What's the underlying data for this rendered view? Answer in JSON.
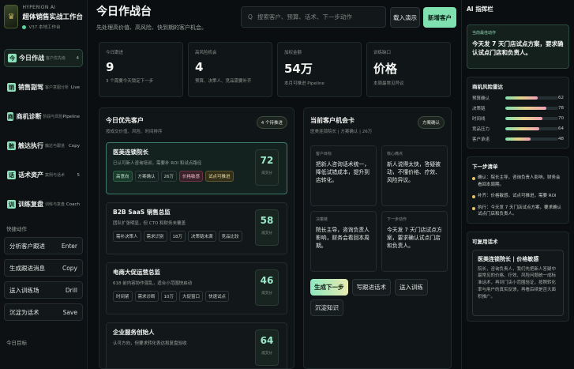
{
  "brand": {
    "tag": "HYPERION AI",
    "title": "超体销售实战工作台",
    "subtitle": "V37 本地工作台",
    "logo_glyph": "♛"
  },
  "nav": [
    {
      "icon": "今",
      "label": "今日作战",
      "sub": "客户优先级",
      "badge": "4",
      "active": true
    },
    {
      "icon": "销",
      "label": "销售副驾",
      "sub": "客户意图分析",
      "badge": "Live",
      "active": false
    },
    {
      "icon": "商",
      "label": "商机诊断",
      "sub": "阶段与风险",
      "badge": "Pipeline",
      "active": false
    },
    {
      "icon": "触",
      "label": "触达执行",
      "sub": "触达与跟进",
      "badge": "Copy",
      "active": false
    },
    {
      "icon": "话",
      "label": "话术资产",
      "sub": "案例与话术",
      "badge": "5",
      "active": false
    },
    {
      "icon": "训",
      "label": "训练复盘",
      "sub": "训练与复盘",
      "badge": "Coach",
      "active": false
    }
  ],
  "quick_actions": {
    "title": "快捷动作",
    "items": [
      {
        "label": "分析客户跟进",
        "key": "Enter"
      },
      {
        "label": "生成跟进消息",
        "key": "Copy"
      },
      {
        "label": "送入训练场",
        "key": "Drill"
      },
      {
        "label": "沉淀为话术",
        "key": "Save"
      }
    ]
  },
  "today_goal_label": "今日目标",
  "header": {
    "title": "今日作战台",
    "subtitle": "先处理高价值、高风险、快到期的客户机会。",
    "search_placeholder": "搜索客户、预算、话术、下一步动作",
    "demo_button": "载入演示",
    "new_button": "新增客户"
  },
  "stats": [
    {
      "label": "今日跟进",
      "value": "9",
      "desc": "3 个需要今天锁定下一步"
    },
    {
      "label": "高风险机会",
      "value": "4",
      "desc": "预算、决策人、竞品需要补齐"
    },
    {
      "label": "加权金额",
      "value": "54万",
      "desc": "本月可推进 Pipeline"
    },
    {
      "label": "训练缺口",
      "value": "价格",
      "desc": "本周最常见异议"
    }
  ],
  "priority": {
    "title": "今日优先客户",
    "subtitle": "按成交价值、风险、时间排序",
    "badge": "4 个待推进",
    "customers": [
      {
        "name": "医美连锁院长",
        "desc": "已认可新人咨询培训，需要补 ROI 和试点路径",
        "tags": [
          {
            "t": "高意向",
            "c": "g"
          },
          {
            "t": "方案确认",
            "c": ""
          },
          {
            "t": "26万",
            "c": ""
          },
          {
            "t": "价格敏感",
            "c": "r"
          },
          {
            "t": "试点可推进",
            "c": "y"
          }
        ],
        "score": "72",
        "score_label": "成交分",
        "selected": true
      },
      {
        "name": "B2B SaaS 销售总监",
        "desc": "团队扩张明显，但 CTO 和财务未覆盖",
        "tags": [
          {
            "t": "需补决策人",
            "c": ""
          },
          {
            "t": "需求识别",
            "c": ""
          },
          {
            "t": "18万",
            "c": ""
          },
          {
            "t": "决策链未满",
            "c": ""
          },
          {
            "t": "竞品比较",
            "c": ""
          }
        ],
        "score": "58",
        "score_label": "成交分",
        "selected": false
      },
      {
        "name": "电商大促运营总监",
        "desc": "618 前内容协作混乱，适合小范围快启动",
        "tags": [
          {
            "t": "时间紧",
            "c": ""
          },
          {
            "t": "需求诊断",
            "c": ""
          },
          {
            "t": "10万",
            "c": ""
          },
          {
            "t": "大促窗口",
            "c": ""
          },
          {
            "t": "快速试点",
            "c": ""
          }
        ],
        "score": "46",
        "score_label": "成交分",
        "selected": false
      },
      {
        "name": "企业服务创始人",
        "desc": "认可方向，但要求转化表达和复盘验收",
        "tags": [],
        "score": "64",
        "score_label": "成交分",
        "selected": false
      }
    ]
  },
  "opportunity": {
    "title": "当前客户机会卡",
    "subtitle": "医美连锁院长 | 方案确认 | 26万",
    "badge": "方案确认",
    "cells": [
      {
        "label": "客户目标",
        "value": "把新人咨询话术统一，降低试错成本，提升到店转化。"
      },
      {
        "label": "核心痛点",
        "value": "新人说得太快，答疑被动，不懂价格、疗效、风险异议。"
      },
      {
        "label": "决策链",
        "value": "院长主导，咨询负责人影响，财务会看回本周期。"
      },
      {
        "label": "下一步动作",
        "value": "今天发 7 天门店试点方案，要求确认试点门店和负责人。"
      }
    ],
    "actions": [
      "生成下一步",
      "写跟进话术",
      "送入训练",
      "沉淀知识"
    ]
  },
  "ai": {
    "title": "AI 指挥栏",
    "best_label": "当前最佳动作",
    "best_value": "今天发 7 天门店试点方案，要求确认试点门店和负责人。",
    "risk_title": "商机风险雷达",
    "risks": [
      {
        "label": "预算确认",
        "value": 62
      },
      {
        "label": "决策链",
        "value": 78
      },
      {
        "label": "时间线",
        "value": 70
      },
      {
        "label": "竞品压力",
        "value": 64
      },
      {
        "label": "客户承诺",
        "value": 48
      }
    ],
    "next_title": "下一步清单",
    "next_steps": [
      "确认：院长主导，咨询负责人影响，财务会看回本周期。",
      "补齐：价格敏感，试点可推进，需要 ROI",
      "执行：今天发 7 天门店试点方案，要求确认试点门店和负责人。"
    ],
    "script_title": "可复用话术",
    "script_name": "医美连锁院长 | 价格敏感",
    "script_text": "院长，咨询负责人，我们先把新人答疑中最常见的价格、疗效、风险问题统一成标准话术，再到门店小范围验证，按照转化率与用户的真实反馈，再看后续是否大面积推广。"
  },
  "colors": {
    "accent": "#7fe0b0",
    "bg": "#0b0e10"
  }
}
